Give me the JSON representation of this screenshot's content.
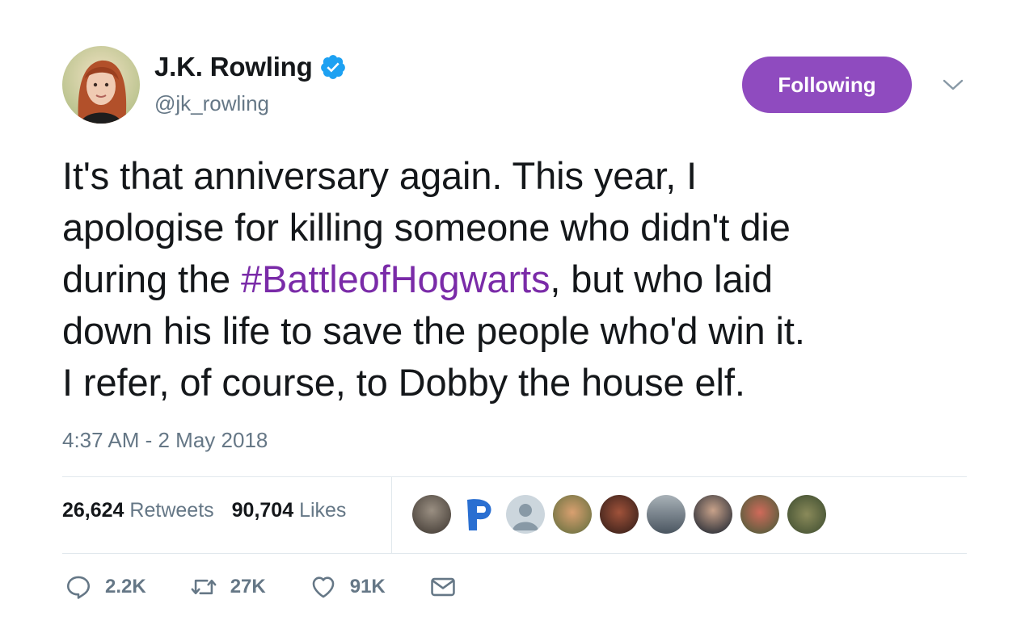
{
  "author": {
    "name": "J.K. Rowling",
    "handle": "@jk_rowling",
    "verified": true
  },
  "follow_button": {
    "label": "Following",
    "color": "#8f4bbf"
  },
  "tweet": {
    "lines": [
      "It's that anniversary again. This year, I",
      "apologise for killing someone who didn't die"
    ],
    "line3_pre": "during the ",
    "hashtag": "#BattleofHogwarts",
    "line3_post": ", but who laid",
    "line4": "down his life to save the people who'd win it.",
    "line5": "I refer, of course, to Dobby the house elf.",
    "hashtag_color": "#7a2ba8"
  },
  "timestamp": "4:37 AM - 2 May 2018",
  "stats": {
    "retweets_count": "26,624",
    "retweets_label": "Retweets",
    "likes_count": "90,704",
    "likes_label": "Likes"
  },
  "actions": {
    "replies": "2.2K",
    "retweets": "27K",
    "likes": "91K"
  },
  "icons": [
    "verified-badge-icon",
    "chevron-down-icon",
    "reply-icon",
    "retweet-icon",
    "like-icon",
    "direct-message-icon"
  ]
}
